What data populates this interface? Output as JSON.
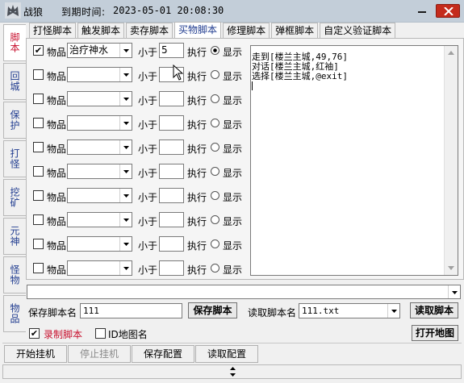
{
  "window": {
    "title": "战狼",
    "expiry_label": "到期时间:",
    "expiry_value": "2023-05-01 20:08:30"
  },
  "side_tabs": [
    "脚本",
    "回城",
    "保护",
    "打怪",
    "挖矿",
    "元神",
    "怪物",
    "物品"
  ],
  "top_tabs": [
    "打怪脚本",
    "触发脚本",
    "卖存脚本",
    "买物脚本",
    "修理脚本",
    "弹框脚本",
    "自定义验证脚本"
  ],
  "active_top_tab": "买物脚本",
  "row_labels": {
    "item": "物品",
    "less_than": "小于",
    "exec": "执行",
    "show": "显示"
  },
  "rows": [
    {
      "checked": true,
      "item": "治疗神水",
      "qty": "5",
      "selected": "显示"
    },
    {
      "checked": false,
      "item": "",
      "qty": "",
      "selected": "执行"
    },
    {
      "checked": false,
      "item": "",
      "qty": "",
      "selected": "执行"
    },
    {
      "checked": false,
      "item": "",
      "qty": "",
      "selected": "执行"
    },
    {
      "checked": false,
      "item": "",
      "qty": "",
      "selected": "执行"
    },
    {
      "checked": false,
      "item": "",
      "qty": "",
      "selected": "执行"
    },
    {
      "checked": false,
      "item": "",
      "qty": "",
      "selected": "执行"
    },
    {
      "checked": false,
      "item": "",
      "qty": "",
      "selected": "执行"
    },
    {
      "checked": false,
      "item": "",
      "qty": "",
      "selected": "执行"
    },
    {
      "checked": false,
      "item": "",
      "qty": "",
      "selected": "执行"
    }
  ],
  "script_lines": [
    "走到[楼兰主城,49,76]",
    "对话[楼兰主城,红袖]",
    "选择[楼兰主城,@exit]"
  ],
  "wide_combo_value": "",
  "save": {
    "label": "保存脚本名",
    "value": "111",
    "button": "保存脚本"
  },
  "load": {
    "label": "读取脚本名",
    "value": "111.txt",
    "button": "读取脚本"
  },
  "record": {
    "label": "录制脚本",
    "checked": true
  },
  "id_map": {
    "label": "ID地图名",
    "checked": false
  },
  "open_map_button": "打开地图",
  "actions": [
    {
      "label": "开始挂机",
      "enabled": true
    },
    {
      "label": "停止挂机",
      "enabled": false
    },
    {
      "label": "保存配置",
      "enabled": true
    },
    {
      "label": "读取配置",
      "enabled": true
    }
  ],
  "colors": {
    "titlebar": "#c3ced9",
    "close_button": "#c42b1c",
    "tab_blue": "#1f3b8f",
    "accent_red": "#c8102e"
  },
  "icons": {
    "app": "wolf-icon",
    "minimize": "minimize-icon",
    "close": "close-icon",
    "dropdown": "chevron-down-icon",
    "radio": "radio-icon",
    "cursor": "mouse-pointer-icon"
  }
}
